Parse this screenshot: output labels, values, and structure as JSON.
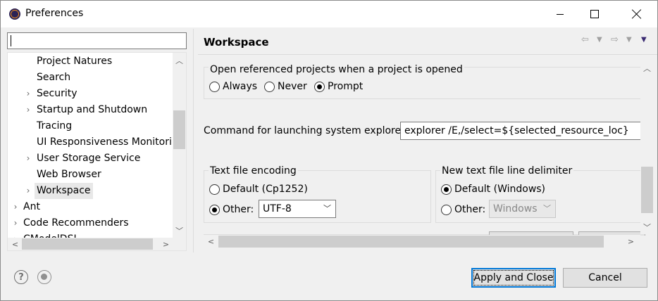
{
  "window": {
    "title": "Preferences"
  },
  "tree": {
    "items": [
      {
        "label": "Project Natures",
        "expandable": false,
        "level": 2
      },
      {
        "label": "Search",
        "expandable": false,
        "level": 2
      },
      {
        "label": "Security",
        "expandable": true,
        "level": 2
      },
      {
        "label": "Startup and Shutdown",
        "expandable": true,
        "level": 2
      },
      {
        "label": "Tracing",
        "expandable": false,
        "level": 2
      },
      {
        "label": "UI Responsiveness Monitoring",
        "expandable": false,
        "level": 2
      },
      {
        "label": "User Storage Service",
        "expandable": true,
        "level": 2
      },
      {
        "label": "Web Browser",
        "expandable": false,
        "level": 2
      },
      {
        "label": "Workspace",
        "expandable": true,
        "level": 2,
        "selected": true
      },
      {
        "label": "Ant",
        "expandable": true,
        "level": 1
      },
      {
        "label": "Code Recommenders",
        "expandable": true,
        "level": 1
      },
      {
        "label": "CModelDSL",
        "expandable": true,
        "level": 1
      }
    ]
  },
  "page": {
    "title": "Workspace"
  },
  "open_projects": {
    "label": "Open referenced projects when a project is opened",
    "options": [
      {
        "label": "Always",
        "mnemonic": "s",
        "checked": false
      },
      {
        "label": "Never",
        "mnemonic": "N",
        "checked": false
      },
      {
        "label": "Prompt",
        "mnemonic": "P",
        "checked": true
      }
    ]
  },
  "explorer": {
    "label": "Command for launching system explorer:",
    "value": "explorer /E,/select=${selected_resource_loc}"
  },
  "encoding": {
    "label": "Text file encoding",
    "default_option": "Default (Cp1252)",
    "other_option": "Other:",
    "other_value": "UTF-8",
    "selected": "other"
  },
  "delimiter": {
    "label": "New text file line delimiter",
    "default_option": "Default (Windows)",
    "other_option": "Other:",
    "other_value": "Windows",
    "selected": "default"
  },
  "buttons": {
    "apply_close": "Apply and Close",
    "cancel": "Cancel"
  },
  "icons": [
    "help-icon",
    "record-macro-icon",
    "back-icon",
    "forward-icon",
    "view-menu-icon"
  ]
}
